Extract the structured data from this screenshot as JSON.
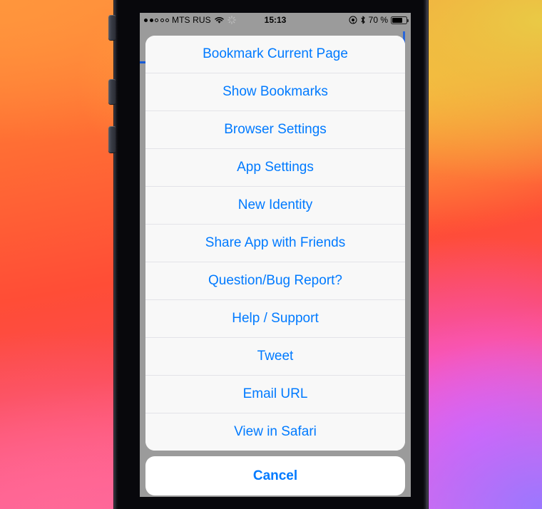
{
  "status_bar": {
    "signal_bars_filled": 2,
    "signal_bars_total": 5,
    "carrier": "MTS RUS",
    "wifi_icon": "wifi-icon",
    "sync_icon": "sync-spinner-icon",
    "time": "15:13",
    "location_icon": "location-services-icon",
    "bluetooth_icon": "bluetooth-icon",
    "battery_percent": "70 %",
    "battery_icon": "battery-icon"
  },
  "action_sheet": {
    "items": [
      {
        "label": "Bookmark Current Page"
      },
      {
        "label": "Show Bookmarks"
      },
      {
        "label": "Browser Settings"
      },
      {
        "label": "App Settings"
      },
      {
        "label": "New Identity"
      },
      {
        "label": "Share App with Friends"
      },
      {
        "label": "Question/Bug Report?"
      },
      {
        "label": "Help / Support"
      },
      {
        "label": "Tweet"
      },
      {
        "label": "Email URL"
      },
      {
        "label": "View in Safari"
      }
    ],
    "cancel_label": "Cancel"
  },
  "colors": {
    "tint": "#007aff",
    "sheet_background": "#f8f8f8",
    "cancel_background": "#ffffff",
    "separator": "#e3e3e8",
    "screen_dim": "#9b9b9b",
    "progress": "#1559d6"
  }
}
